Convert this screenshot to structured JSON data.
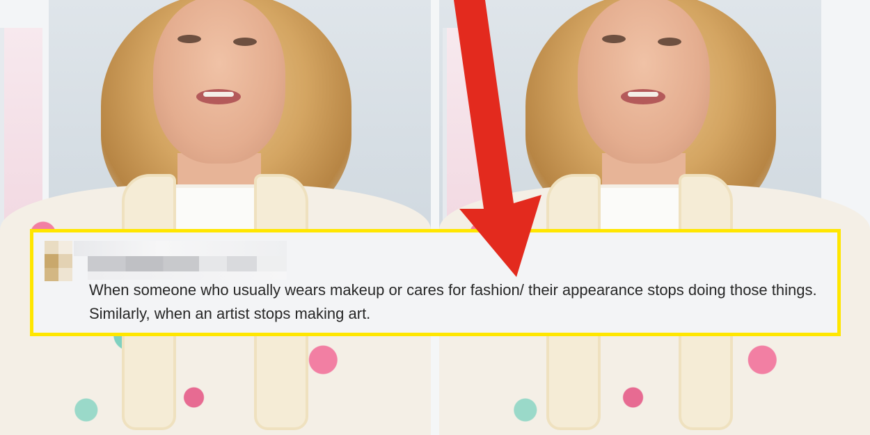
{
  "post": {
    "comment_text": "When someone who usually wears makeup or cares for fashion/ their appearance stops doing those things. Similarly, when an artist stops making art."
  },
  "colors": {
    "highlight_border": "#ffe600",
    "arrow": "#e32a1e",
    "card_background": "#f3f4f6",
    "text": "#262626"
  },
  "icons": {
    "arrow": "down-arrow-icon",
    "avatar": "pixelated-avatar-icon"
  }
}
